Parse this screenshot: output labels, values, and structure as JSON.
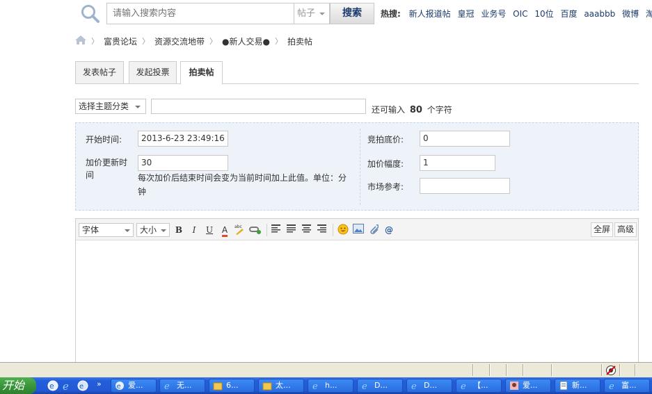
{
  "search": {
    "placeholder": "请输入搜索内容",
    "type_value": "帖子",
    "button_label": "搜索"
  },
  "hot": {
    "label": "热搜:",
    "items": [
      "新人报道帖",
      "皇冠",
      "业务号",
      "OIC",
      "10位",
      "百度",
      "aaabbb",
      "微博",
      "淘宝店"
    ]
  },
  "breadcrumb": [
    "富贵论坛",
    "资源交流地带",
    "●新人交易●",
    "拍卖帖"
  ],
  "tabs": [
    {
      "label": "发表帖子",
      "active": false
    },
    {
      "label": "发起投票",
      "active": false
    },
    {
      "label": "拍卖帖",
      "active": true
    }
  ],
  "subject": {
    "topic_select": "选择主题分类",
    "char_left_prefix": "还可输入",
    "char_left_count": "80",
    "char_left_suffix": "个字符"
  },
  "auction": {
    "start_time_label": "开始时间:",
    "start_time_value": "2013-6-23 23:49:16",
    "extend_label": "加价更新时间",
    "extend_value": "30",
    "extend_hint": "每次加价后结束时间会变为当前时间加上此值。单位：分钟",
    "base_price_label": "竞拍底价:",
    "base_price_value": "0",
    "increment_label": "加价幅度:",
    "increment_value": "1",
    "market_label": "市场参考:",
    "market_value": ""
  },
  "editor": {
    "font_select": "字体",
    "size_select": "大小",
    "bold": "B",
    "italic": "I",
    "underline": "U",
    "fontcolor": "A",
    "fullscreen": "全屏",
    "advanced": "高级"
  },
  "taskbar": {
    "start_label": "开始",
    "chevron": "»",
    "windows": [
      "爱...",
      "无...",
      "6...",
      "太...",
      "h...",
      "D...",
      "D...",
      "【...",
      "爱...",
      "新...",
      "富..."
    ]
  },
  "colors": {
    "link": "#1a3a6c",
    "panel_bg": "#eef3f9",
    "taskbar": "#245edb",
    "start": "#3a963a"
  }
}
